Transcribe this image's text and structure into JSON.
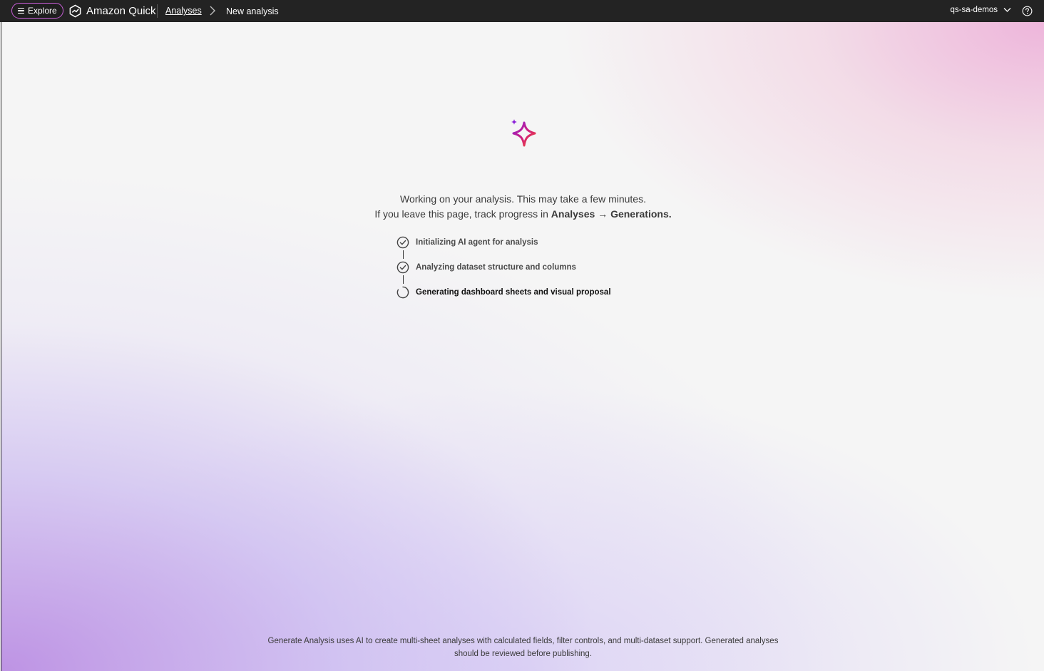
{
  "topbar": {
    "explore_label": "Explore",
    "brand_name": "Amazon Quick",
    "breadcrumb": {
      "parent": "Analyses",
      "current": "New analysis"
    },
    "account_name": "qs-sa-demos",
    "icons": [
      "hamburger-icon",
      "quick-logo-icon",
      "chevron-right-icon",
      "chevron-down-icon",
      "help-icon"
    ]
  },
  "main": {
    "sparkle_icon": "ai-sparkle-icon",
    "message_line1": "Working on your analysis. This may take a few minutes.",
    "message_line2_prefix": "If you leave this page, track progress in",
    "message_line2_bold_a": "Analyses",
    "message_line2_arrow": "→",
    "message_line2_bold_b": "Generations.",
    "steps": [
      {
        "label": "Initializing AI agent for analysis",
        "status": "completed",
        "icon": "check-circle-icon"
      },
      {
        "label": "Analyzing dataset structure and columns",
        "status": "completed",
        "icon": "check-circle-icon"
      },
      {
        "label": "Generating dashboard sheets and visual proposal",
        "status": "in-progress",
        "icon": "spinner-icon"
      }
    ],
    "footer_line1": "Generate Analysis uses AI to create multi-sheet analyses with calculated fields, filter controls, and multi-dataset support. Generated analyses",
    "footer_line2": "should be reviewed before publishing."
  },
  "colors": {
    "topbar_bg": "#232323",
    "explore_border": "#c95fd8",
    "sparkle_gradient": [
      "#8a1fd8",
      "#d2207a",
      "#f4502a"
    ]
  }
}
